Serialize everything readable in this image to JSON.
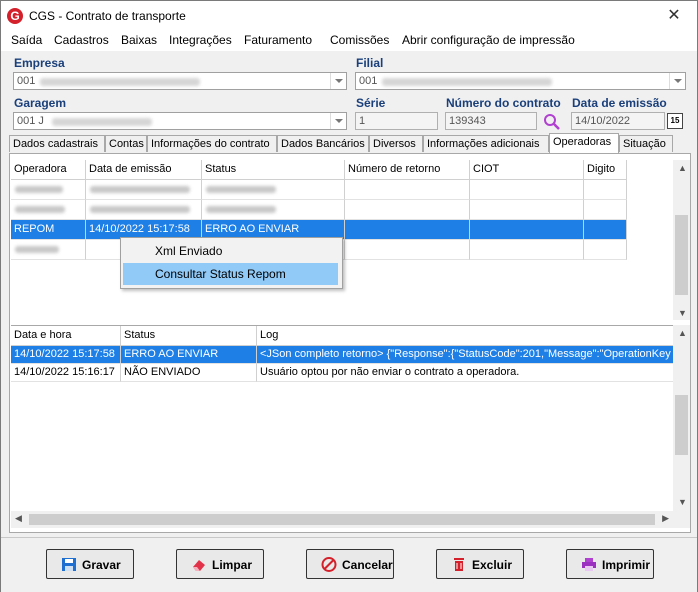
{
  "window": {
    "title": "CGS - Contrato de transporte",
    "close": "✕"
  },
  "menu": [
    "Saída",
    "Cadastros",
    "Baixas",
    "Integrações",
    "Faturamento",
    "Comissões",
    "Abrir configuração de impressão"
  ],
  "form": {
    "empresa_label": "Empresa",
    "empresa_value": "001",
    "filial_label": "Filial",
    "filial_value": "001",
    "garagem_label": "Garagem",
    "garagem_value": "001 J",
    "serie_label": "Série",
    "serie_value": "1",
    "numero_label": "Número do contrato",
    "numero_value": "139343",
    "data_label": "Data de emissão",
    "data_value": "14/10/2022",
    "calendar_glyph": "15"
  },
  "tabs": [
    "Dados cadastrais",
    "Contas",
    "Informações do contrato",
    "Dados Bancários",
    "Diversos",
    "Informações adicionais",
    "Operadoras",
    "Situação"
  ],
  "operators_grid": {
    "columns": [
      "Operadora",
      "Data de emissão",
      "Status",
      "Número de retorno",
      "CIOT",
      "Digito"
    ],
    "selected_row": {
      "operadora": "REPOM",
      "data": "14/10/2022 15:17:58",
      "status": "ERRO AO ENVIAR"
    }
  },
  "context_menu": [
    "Xml Enviado",
    "Consultar Status Repom"
  ],
  "log_grid": {
    "columns": [
      "Data e hora",
      "Status",
      "Log"
    ],
    "rows": [
      {
        "data": "14/10/2022 15:17:58",
        "status": "ERRO AO ENVIAR",
        "log": "<JSon completo retorno> {\"Response\":{\"StatusCode\":201,\"Message\":\"OperationKey"
      },
      {
        "data": "14/10/2022 15:16:17",
        "status": "NÃO ENVIADO",
        "log": "Usuário optou por não enviar o contrato a operadora."
      }
    ]
  },
  "buttons": {
    "gravar": "Gravar",
    "limpar": "Limpar",
    "cancelar": "Cancelar",
    "excluir": "Excluir",
    "imprimir": "Imprimir"
  },
  "colors": {
    "selection": "#1e7fe6",
    "label": "#1a3f7a",
    "menu_highlight": "#91c9f7"
  }
}
